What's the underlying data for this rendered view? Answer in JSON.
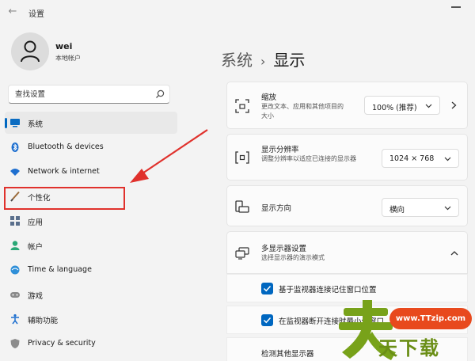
{
  "window": {
    "title": "设置"
  },
  "profile": {
    "name": "wei",
    "account_type": "本地帐户"
  },
  "search": {
    "placeholder": "查找设置"
  },
  "nav": {
    "items": [
      {
        "label": "系统",
        "icon": "monitor-icon",
        "active": true
      },
      {
        "label": "Bluetooth & devices",
        "icon": "bluetooth-icon"
      },
      {
        "label": "Network & internet",
        "icon": "wifi-icon"
      },
      {
        "label": "个性化",
        "icon": "brush-icon"
      },
      {
        "label": "应用",
        "icon": "apps-icon"
      },
      {
        "label": "帐户",
        "icon": "person-icon"
      },
      {
        "label": "Time & language",
        "icon": "globe-clock-icon"
      },
      {
        "label": "游戏",
        "icon": "gamepad-icon"
      },
      {
        "label": "辅助功能",
        "icon": "accessibility-icon"
      },
      {
        "label": "Privacy & security",
        "icon": "shield-icon"
      }
    ]
  },
  "breadcrumb": {
    "parent": "系统",
    "separator": "›",
    "current": "显示"
  },
  "settings": {
    "scale": {
      "title": "缩放",
      "description": "更改文本、应用和其他项目的大小",
      "value": "100% (推荐)"
    },
    "resolution": {
      "title": "显示分辨率",
      "description": "调整分辨率以适应已连接的显示器",
      "value": "1024 × 768"
    },
    "orientation": {
      "title": "显示方向",
      "value": "横向"
    },
    "multi_display": {
      "title": "多显示器设置",
      "description": "选择显示器的演示模式",
      "remember_positions": "基于监视器连接记住窗口位置",
      "minimize_on_disconnect": "在监视器断开连接时最小化窗口",
      "detect_other": "检测其他显示器"
    }
  },
  "watermark": {
    "site": "www.TTzip.com",
    "chars": "天下载"
  },
  "colors": {
    "accent": "#0067c0",
    "annotation": "#e0312c",
    "watermark_orange": "#e8491d",
    "watermark_green": "#6a8e16"
  }
}
